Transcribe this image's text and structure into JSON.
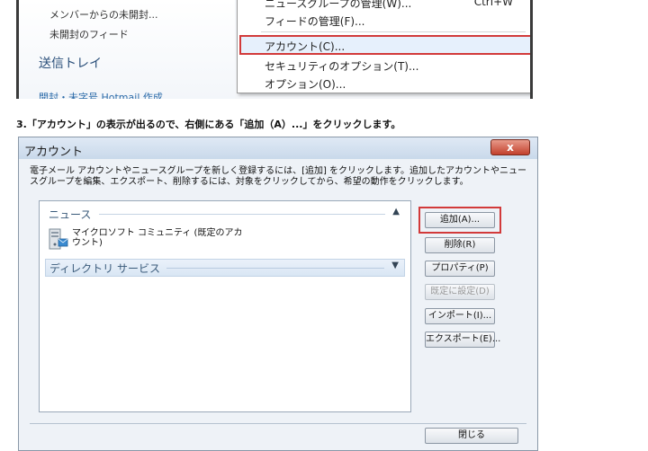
{
  "top_sidebar": {
    "items": [
      "メンバーからの未開封...",
      "未開封のフィード"
    ],
    "outbox": "送信トレイ",
    "cut_item": "開封・未字号 Hotmail 作成"
  },
  "top_menu": {
    "items": [
      {
        "label": "ニュースグループの管理(W)...",
        "shortcut": "Ctrl+W"
      },
      {
        "label": "フィードの管理(F)...",
        "shortcut": ""
      },
      {
        "label": "アカウント(C)...",
        "shortcut": "",
        "highlighted": true
      },
      {
        "label": "セキュリティのオプション(T)...",
        "shortcut": ""
      },
      {
        "label": "オプション(O)...",
        "shortcut": ""
      }
    ]
  },
  "instruction": "3.「アカウント」の表示が出るので、右側にある「追加（A）...」をクリックします。",
  "dialog": {
    "title": "アカウント",
    "close_glyph": "x",
    "description": "電子メール アカウントやニュースグループを新しく登録するには、[追加] をクリックします。追加したアカウントやニュースグループを編集、エクスポート、削除するには、対象をクリックしてから、希望の動作をクリックします。",
    "groups": [
      {
        "label": "ニュース",
        "chevron": "▲"
      },
      {
        "label": "ディレクトリ サービス",
        "chevron": "▼"
      }
    ],
    "account_name": "マイクロソフト コミュニティ (既定のアカウント)",
    "buttons": {
      "add": "追加(A)...",
      "delete": "削除(R)",
      "properties": "プロパティ(P)",
      "set_default": "既定に設定(D)",
      "import": "インポート(I)...",
      "export": "エクスポート(E)...",
      "close": "閉じる"
    },
    "accent": "#d23a3a"
  }
}
